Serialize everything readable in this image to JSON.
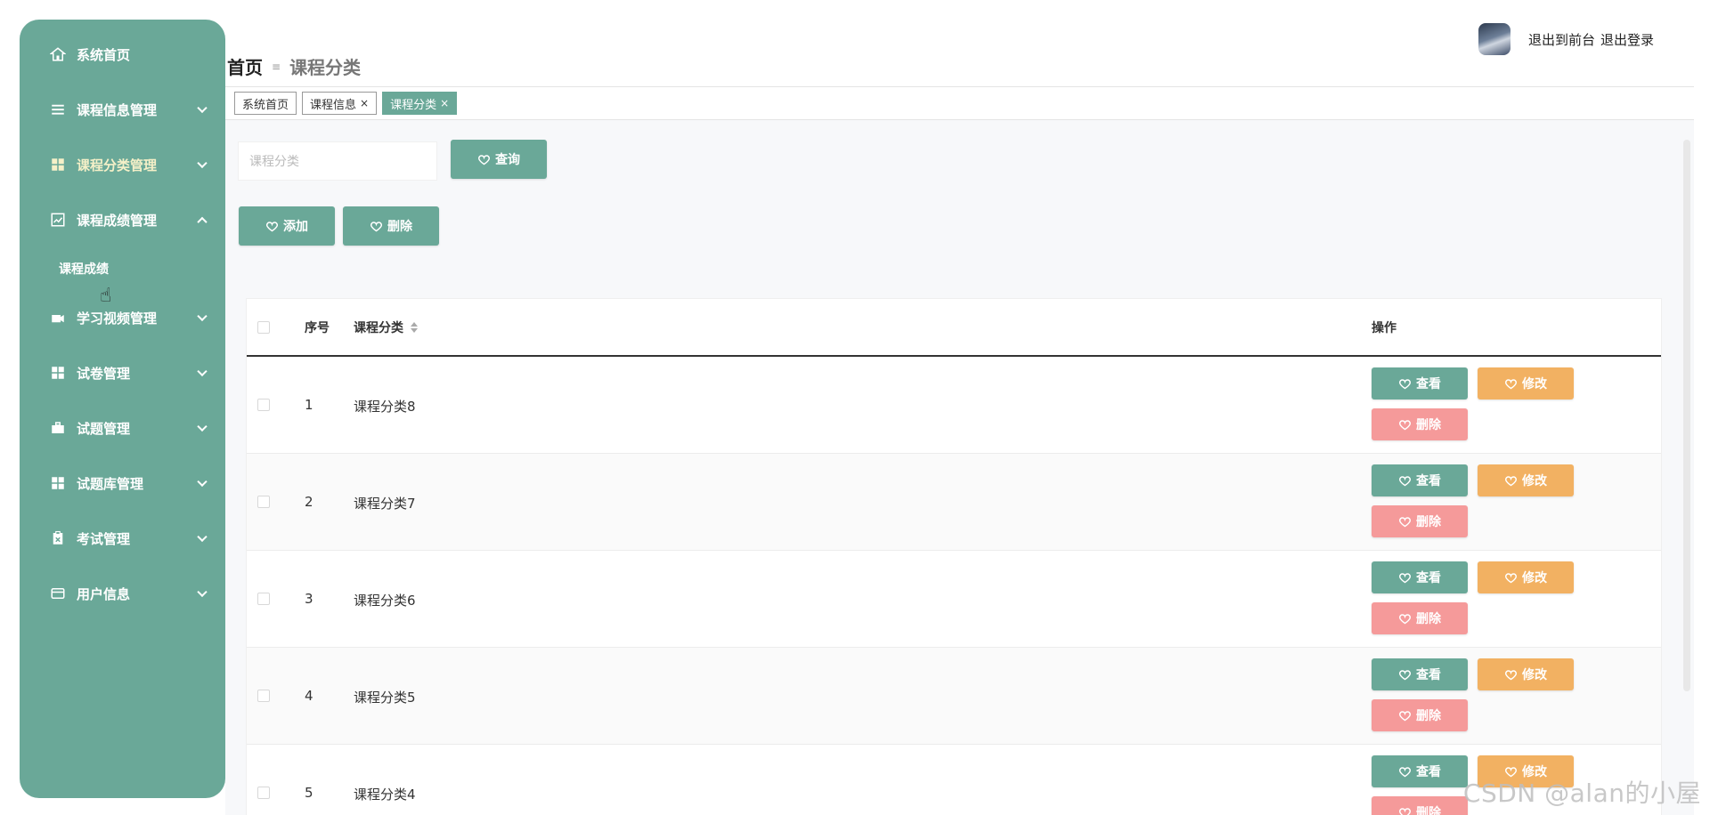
{
  "sidebar": {
    "items": [
      {
        "label": "系统首页",
        "icon": "home-icon",
        "has_chevron": false
      },
      {
        "label": "课程信息管理",
        "icon": "list-icon",
        "has_chevron": true
      },
      {
        "label": "课程分类管理",
        "icon": "grid-icon",
        "has_chevron": true,
        "active": true
      },
      {
        "label": "课程成绩管理",
        "icon": "chart-icon",
        "has_chevron": true,
        "expanded": true
      },
      {
        "label": "学习视频管理",
        "icon": "video-icon",
        "has_chevron": true
      },
      {
        "label": "试卷管理",
        "icon": "grid-icon",
        "has_chevron": true
      },
      {
        "label": "试题管理",
        "icon": "briefcase-icon",
        "has_chevron": true
      },
      {
        "label": "试题库管理",
        "icon": "grid-icon",
        "has_chevron": true
      },
      {
        "label": "考试管理",
        "icon": "clipboard-icon",
        "has_chevron": true
      },
      {
        "label": "用户信息",
        "icon": "card-icon",
        "has_chevron": true
      }
    ],
    "sub_item": "课程成绩"
  },
  "header": {
    "breadcrumb_home": "首页",
    "breadcrumb_sep": "≡",
    "breadcrumb_current": "课程分类",
    "link_frontend": "退出到前台",
    "link_logout": "退出登录"
  },
  "tabs": [
    {
      "label": "系统首页",
      "closable": false,
      "active": false
    },
    {
      "label": "课程信息",
      "closable": true,
      "active": false
    },
    {
      "label": "课程分类",
      "closable": true,
      "active": true
    }
  ],
  "tab_close_glyph": "×",
  "search": {
    "placeholder": "课程分类",
    "query_label": "查询"
  },
  "toolbar": {
    "add_label": "添加",
    "delete_label": "删除"
  },
  "table": {
    "headers": {
      "no": "序号",
      "name": "课程分类",
      "actions": "操作"
    },
    "rows": [
      {
        "no": "1",
        "name": "课程分类8"
      },
      {
        "no": "2",
        "name": "课程分类7"
      },
      {
        "no": "3",
        "name": "课程分类6"
      },
      {
        "no": "4",
        "name": "课程分类5"
      },
      {
        "no": "5",
        "name": "课程分类4"
      }
    ],
    "row_actions": {
      "view": "查看",
      "edit": "修改",
      "delete": "删除"
    }
  },
  "colors": {
    "accent": "#6aa898",
    "edit": "#f2b162",
    "danger": "#f59a9a"
  },
  "watermark": "CSDN @alan的小屋"
}
